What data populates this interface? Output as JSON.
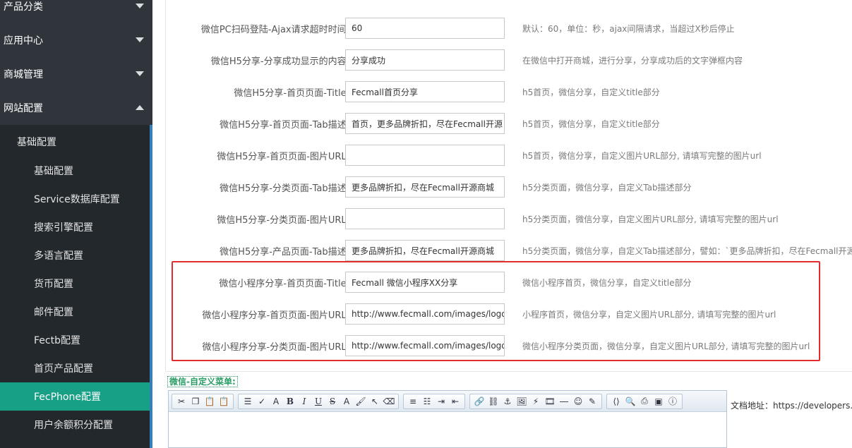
{
  "sidebar": {
    "top_items": [
      {
        "label": "产品分类",
        "expanded": false
      },
      {
        "label": "应用中心",
        "expanded": false
      },
      {
        "label": "商城管理",
        "expanded": false
      },
      {
        "label": "网站配置",
        "expanded": true
      }
    ],
    "submenu_header": "基础配置",
    "submenu_items": [
      {
        "label": "基础配置",
        "active": false
      },
      {
        "label": "Service数据库配置",
        "active": false
      },
      {
        "label": "搜索引擎配置",
        "active": false
      },
      {
        "label": "多语言配置",
        "active": false
      },
      {
        "label": "货币配置",
        "active": false
      },
      {
        "label": "邮件配置",
        "active": false
      },
      {
        "label": "Fectb配置",
        "active": false
      },
      {
        "label": "首页产品配置",
        "active": false
      },
      {
        "label": "FecPhone配置",
        "active": true
      },
      {
        "label": "用户余额积分配置",
        "active": false
      }
    ],
    "active_color": "#17a086"
  },
  "rows": [
    {
      "label": "微信PC扫码登陆-Ajax请求超时时间:",
      "value": "60",
      "help": "默认：60，单位：秒，ajax间隔请求，当超过X秒后停止"
    },
    {
      "label": "微信H5分享-分享成功显示的内容:",
      "value": "分享成功",
      "help": "在微信中打开商城，进行分享，分享成功后的文字弹框内容"
    },
    {
      "label": "微信H5分享-首页页面-Title:",
      "value": "Fecmall首页分享",
      "help": "h5首页，微信分享，自定义title部分"
    },
    {
      "label": "微信H5分享-首页页面-Tab描述:",
      "value": "首页，更多品牌折扣，尽在Fecmall开源",
      "help": "h5首页，微信分享，自定义title部分"
    },
    {
      "label": "微信H5分享-首页页面-图片URL:",
      "value": "",
      "help": "h5首页，微信分享，自定义图片URL部分, 请填写完整的图片url"
    },
    {
      "label": "微信H5分享-分类页面-Tab描述:",
      "value": "更多品牌折扣，尽在Fecmall开源商城",
      "help": "h5分类页面，微信分享，自定义Tab描述部分"
    },
    {
      "label": "微信H5分享-分类页面-图片URL:",
      "value": "",
      "help": "h5分类页面，微信分享，自定义图片URL部分, 请填写完整的图片url"
    },
    {
      "label": "微信H5分享-产品页面-Tab描述:",
      "value": "更多品牌折扣，尽在Fecmall开源商城",
      "help": "h5分类页面，微信分享，自定义Tab描述部分，譬如：`更多品牌折扣，尽在Fecmall开源商"
    },
    {
      "label": "微信小程序分享-首页页面-Title:",
      "value": "Fecmall 微信小程序XX分享",
      "help": "微信小程序首页，微信分享，自定义title部分"
    },
    {
      "label": "微信小程序分享-首页页面-图片URL:",
      "value": "http://www.fecmall.com/images/logo.pn",
      "help": "小程序首页，微信分享，自定义图片URL部分, 请填写完整的图片url"
    },
    {
      "label": "微信小程序分享-分类页面-图片URL:",
      "value": "http://www.fecmall.com/images/logo.pn",
      "help": "微信小程序分类页面，微信分享，自定义图片URL部分, 请填写完整的图片url"
    }
  ],
  "editor": {
    "label": "微信-自定义菜单:",
    "toolbar_groups": [
      [
        {
          "icon": "cut-icon",
          "glyph": "✂"
        },
        {
          "icon": "copy-icon",
          "glyph": "❐"
        },
        {
          "icon": "paste-icon",
          "glyph": "📋"
        },
        {
          "icon": "paste-text-icon",
          "glyph": "📋"
        }
      ],
      [
        {
          "icon": "line-height-icon",
          "glyph": "☰"
        },
        {
          "icon": "spellcheck-icon",
          "glyph": "✓"
        },
        {
          "icon": "font-size-icon",
          "glyph": "A"
        },
        {
          "icon": "bold-icon",
          "glyph": "B"
        },
        {
          "icon": "italic-icon",
          "glyph": "I"
        },
        {
          "icon": "underline-icon",
          "glyph": "U"
        },
        {
          "icon": "strikethrough-icon",
          "glyph": "S"
        },
        {
          "icon": "text-color-icon",
          "glyph": "A"
        },
        {
          "icon": "highlight-icon",
          "glyph": "🖌"
        },
        {
          "icon": "select-icon",
          "glyph": "↖"
        },
        {
          "icon": "eraser-icon",
          "glyph": "⌫"
        }
      ],
      [
        {
          "icon": "align-left-icon",
          "glyph": "≡"
        },
        {
          "icon": "list-icon",
          "glyph": "☷"
        },
        {
          "icon": "indent-icon",
          "glyph": "⇥"
        },
        {
          "icon": "outdent-icon",
          "glyph": "⇤"
        }
      ],
      [
        {
          "icon": "link-icon",
          "glyph": "🔗"
        },
        {
          "icon": "unlink-icon",
          "glyph": "⛓"
        },
        {
          "icon": "anchor-icon",
          "glyph": "⚓"
        },
        {
          "icon": "image-icon",
          "glyph": "🖼"
        },
        {
          "icon": "flash-icon",
          "glyph": "⚡"
        },
        {
          "icon": "media-icon",
          "glyph": "🎞"
        },
        {
          "icon": "hr-icon",
          "glyph": "―"
        },
        {
          "icon": "emoticon-icon",
          "glyph": "☺"
        },
        {
          "icon": "note-icon",
          "glyph": "✎"
        }
      ],
      [
        {
          "icon": "source-icon",
          "glyph": "⟨⟩"
        },
        {
          "icon": "preview-icon",
          "glyph": "🔍"
        },
        {
          "icon": "print-icon",
          "glyph": "⎙"
        },
        {
          "icon": "fullscreen-icon",
          "glyph": "▣"
        },
        {
          "icon": "about-icon",
          "glyph": "ⓘ"
        }
      ]
    ]
  },
  "doc_address": "文档地址：https://developers.we",
  "colors": {
    "highlight_border": "#e32d2d",
    "sidebar_bg": "#2f353b",
    "submenu_bg": "#23282d"
  }
}
